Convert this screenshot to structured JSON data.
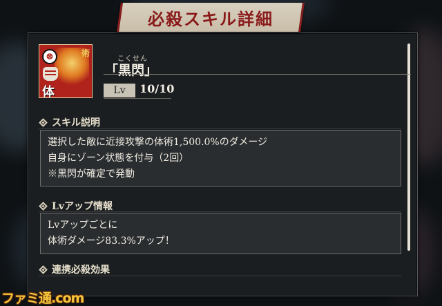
{
  "title": "必殺スキル詳細",
  "skill": {
    "ruby": "こくせん",
    "name": "「黒閃」",
    "icon": {
      "type_glyph": "⊗",
      "attribute_kanji": "体",
      "rank_text": "術"
    },
    "level_label": "Lv",
    "level_value": "10/10"
  },
  "sections": [
    {
      "heading": "スキル説明",
      "lines": [
        "選択した敵に近接攻撃の体術1,500.0%のダメージ",
        "自身にゾーン状態を付与（2回）",
        "※黒閃が確定で発動"
      ]
    },
    {
      "heading": "Lvアップ情報",
      "lines": [
        "Lvアップごとに",
        "体術ダメージ83.3%アップ！"
      ]
    },
    {
      "heading": "連携必殺効果",
      "lines": []
    }
  ],
  "watermark": "ファミ通.com",
  "colors": {
    "title_text": "#8a1a1a",
    "icon_bg": "#b0231c",
    "watermark": "#f6c63a"
  }
}
